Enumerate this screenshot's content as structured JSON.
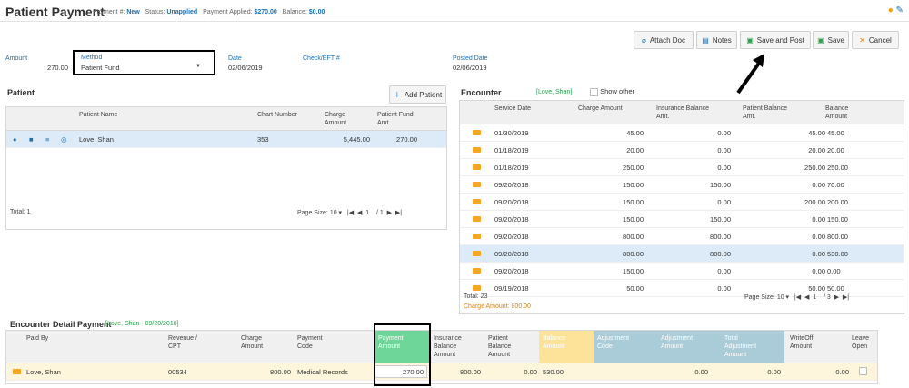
{
  "header": {
    "title": "Patient Payment",
    "payment_label": "Payment #:",
    "payment_val": "New",
    "status_label": "Status:",
    "status_val": "Unapplied",
    "applied_label": "Payment Applied:",
    "applied_val": "$270.00",
    "balance_label": "Balance:",
    "balance_val": "$0.00"
  },
  "toolbar": {
    "attach": "Attach Doc",
    "notes": "Notes",
    "save_post": "Save and Post",
    "save": "Save",
    "cancel": "Cancel"
  },
  "form": {
    "amount_label": "Amount",
    "amount_val": "270.00",
    "method_label": "Method",
    "method_val": "Patient Fund",
    "date_label": "Date",
    "date_val": "02/06/2019",
    "check_label": "Check/EFT #",
    "posted_label": "Posted Date",
    "posted_val": "02/06/2019"
  },
  "patient": {
    "title": "Patient",
    "add": "Add Patient",
    "cols": [
      "Patient Name",
      "Chart Number",
      "Charge Amount",
      "Patient Fund Amt."
    ],
    "row": {
      "name": "Love, Shan",
      "chart": "353",
      "charge": "5,445.00",
      "fund": "270.00"
    },
    "total": "Total: 1",
    "page_size_label": "Page Size:",
    "page_size": "10",
    "page": "1",
    "of": "/ 1"
  },
  "encounter": {
    "title": "Encounter",
    "tag": "[Love, Shan]",
    "show_other": "Show other",
    "cols": [
      "Service Date",
      "Charge Amount",
      "Insurance Balance Amt.",
      "Patient Balance Amt.",
      "Balance Amount"
    ],
    "rows": [
      [
        "01/30/2019",
        "45.00",
        "0.00",
        "45.00",
        "45.00"
      ],
      [
        "01/18/2019",
        "20.00",
        "0.00",
        "20.00",
        "20.00"
      ],
      [
        "01/18/2019",
        "250.00",
        "0.00",
        "250.00",
        "250.00"
      ],
      [
        "09/20/2018",
        "150.00",
        "150.00",
        "0.00",
        "70.00"
      ],
      [
        "09/20/2018",
        "150.00",
        "0.00",
        "200.00",
        "200.00"
      ],
      [
        "09/20/2018",
        "150.00",
        "150.00",
        "0.00",
        "150.00"
      ],
      [
        "09/20/2018",
        "800.00",
        "800.00",
        "0.00",
        "800.00"
      ],
      [
        "09/20/2018",
        "800.00",
        "800.00",
        "0.00",
        "530.00"
      ],
      [
        "09/20/2018",
        "150.00",
        "0.00",
        "0.00",
        "0.00"
      ],
      [
        "09/19/2018",
        "50.00",
        "0.00",
        "50.00",
        "50.00"
      ]
    ],
    "total": "Total: 23",
    "charge_amount": "Charge Amount: 800.00",
    "page_size_label": "Page Size:",
    "page_size": "10",
    "page": "1",
    "of": "/ 3"
  },
  "detail": {
    "title": "Encounter Detail Payment",
    "tag": "[Love, Shan  - 09/20/2018]",
    "cols": [
      "Paid By",
      "Revenue / CPT",
      "Charge Amount",
      "Payment Code",
      "Payment Amount",
      "Insurance Balance Amount",
      "Patient Balance Amount",
      "Balance Amount",
      "Adjustment Code",
      "Adjustment Amount",
      "Total Adjustment Amount",
      "WriteOff Amount",
      "Leave Open"
    ],
    "row": {
      "paid_by": "Love, Shan",
      "cpt": "00534",
      "charge": "800.00",
      "code": "Medical Records",
      "payment": "270.00",
      "ins": "800.00",
      "pat": "0.00",
      "bal": "530.00",
      "adj": "0.00",
      "total_adj": "0.00",
      "writeoff": "0.00"
    }
  },
  "colors": {
    "accent": "#1a6fb5",
    "green": "#6fd69a",
    "yellow": "#fde39a",
    "teal": "#a9ccd8",
    "folder": "#f5a623"
  }
}
